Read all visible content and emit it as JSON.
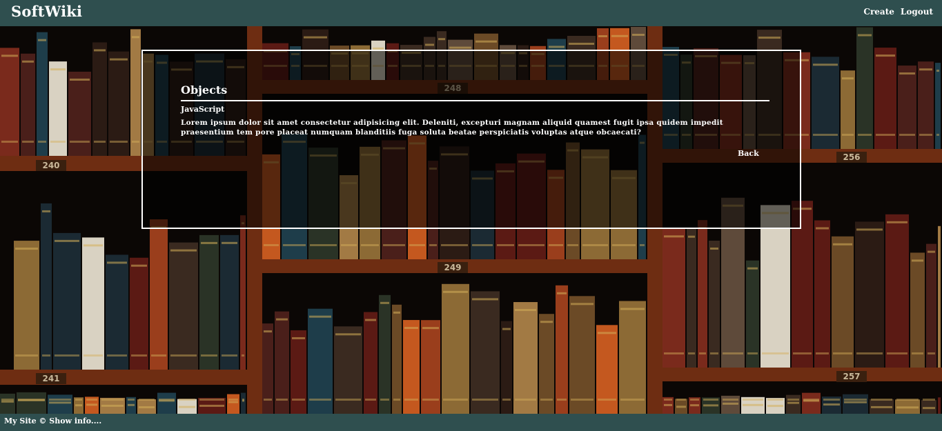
{
  "header": {
    "brand": "SoftWiki",
    "nav": {
      "create": "Create",
      "logout": "Logout"
    }
  },
  "background": {
    "shelf_numbers": [
      "240",
      "241",
      "248",
      "249",
      "256",
      "257"
    ]
  },
  "article": {
    "title": "Objects",
    "category": "JavaScript",
    "content": "Lorem ipsum dolor sit amet consectetur adipisicing elit. Deleniti, excepturi magnam aliquid quamest fugit ipsa quidem impedit praesentium tem pore placeat numquam blanditiis fuga soluta beatae perspiciatis voluptas atque obcaecati?",
    "back_label": "Back"
  },
  "footer": {
    "text": "My Site © Show info...."
  },
  "colors": {
    "bar": "#2f4f4f",
    "text": "#ffffff",
    "shelf_wood": "#6e2d12"
  }
}
